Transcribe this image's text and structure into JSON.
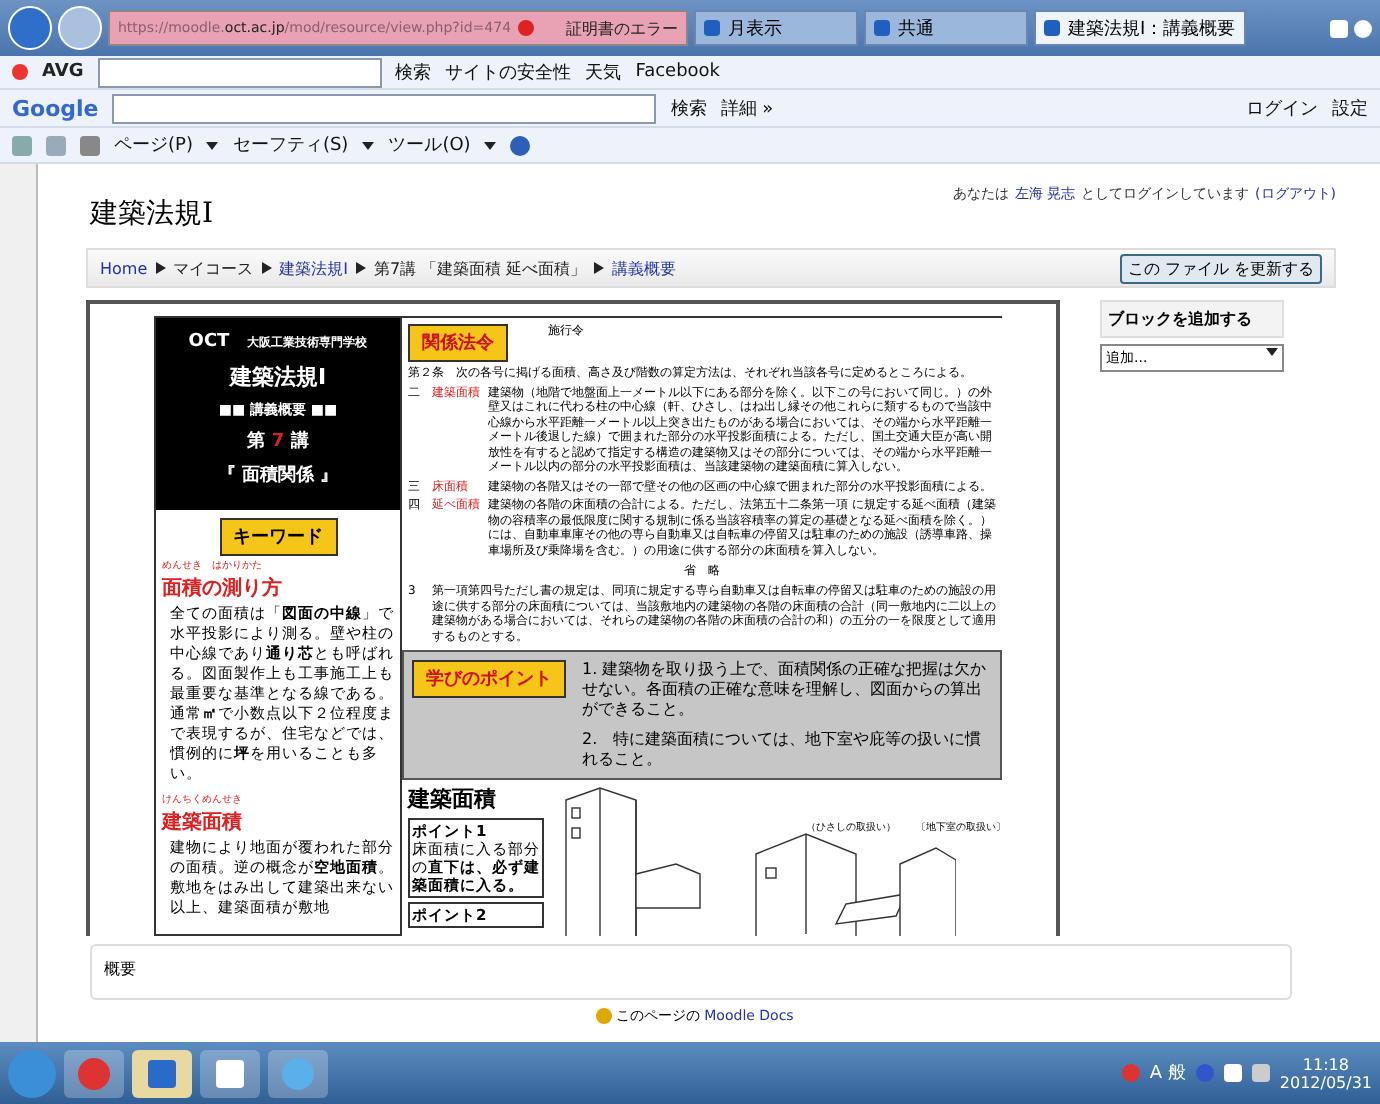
{
  "browser": {
    "url_prefix": "https://moodle.",
    "url_host": "oct.ac.jp",
    "url_path": "/mod/resource/view.php?id=474",
    "cert_error": "証明書のエラー",
    "tabs": [
      {
        "label": "月表示",
        "selected": false
      },
      {
        "label": "共通",
        "selected": false
      },
      {
        "label": "建築法規Ⅰ：講義概要",
        "selected": true
      }
    ]
  },
  "avg_toolbar": {
    "logo": "AVG",
    "search": "検索",
    "site_safety": "サイトの安全性",
    "weather": "天気",
    "facebook": "Facebook"
  },
  "google_toolbar": {
    "logo": "Google",
    "search": "検索",
    "more": "詳細 »",
    "login": "ログイン",
    "settings": "設定"
  },
  "command_bar": {
    "menus": [
      "ページ(P)",
      "セーフティ(S)",
      "ツール(O)"
    ]
  },
  "page": {
    "title": "建築法規Ⅰ",
    "login_prefix": "あなたは",
    "user": "左海 晃志",
    "login_suffix": "としてログインしています",
    "logout": "(ログアウト)",
    "breadcrumb": [
      {
        "label": "Home",
        "link": true
      },
      {
        "label": "マイコース",
        "link": false
      },
      {
        "label": "建築法規Ⅰ",
        "link": true
      },
      {
        "label": "第7講 「建築面積 延べ面積」",
        "link": false
      },
      {
        "label": "講義概要",
        "link": true
      }
    ],
    "update_button": "この ファイル を更新する",
    "block": {
      "title": "ブロックを追加する",
      "select": "追加..."
    },
    "summary": "概要",
    "docs_prefix": "このページの",
    "docs_link": "Moodle Docs"
  },
  "document": {
    "school": "OCT",
    "school_name": "大阪工業技術専門学校",
    "course": "建築法規Ⅰ",
    "subtitle": "■■ 講義概要 ■■",
    "lecture_prefix": "第",
    "lecture_no": "7",
    "lecture_suffix": "講",
    "topic": "『 面積関係 』",
    "keyword_label": "キーワード",
    "keywords": [
      {
        "ruby": "めんせき　はかりかた",
        "term": "面積の測り方",
        "text": "全ての面積は「**図面の中線**」で水平投影により測る。壁や柱の中心線であり**通り芯**とも呼ばれる。図面製作上も工事施工上も最重要な基準となる線である。通常**㎡**で小数点以下２位程度まで表現するが、住宅などでは、慣例的に**坪**を用いることも多い。"
      },
      {
        "ruby": "けんちくめんせき",
        "term": "建築面積",
        "text": "建物により地面が覆われた部分の面積。逆の概念が**空地面積**。敷地をはみ出して建築出来ない以上、建築面積が敷地"
      }
    ],
    "law_label": "関係法令",
    "law_title": "施行令",
    "law_intro": "第２条　次の各号に掲げる面積、高さ及び階数の算定方法は、それぞれ当該各号に定めるところによる。",
    "law_items": [
      {
        "no": "二",
        "term": "建築面積",
        "text": "建築物（地階で地盤面上一メートル以下にある部分を除く。以下この号において同じ。）の外壁又はこれに代わる柱の中心線（軒、ひさし、はね出し縁その他これらに類するもので当該中心線から水平距離一メートル以上突き出たものがある場合においては、その端から水平距離一メートル後退した線）で囲まれた部分の水平投影面積による。ただし、国土交通大臣が高い開放性を有すると認めて指定する構造の建築物又はその部分については、その端から水平距離一メートル以内の部分の水平投影面積は、当該建築物の建築面積に算入しない。"
      },
      {
        "no": "三",
        "term": "床面積",
        "text": "建築物の各階又はその一部で壁その他の区画の中心線で囲まれた部分の水平投影面積による。"
      },
      {
        "no": "四",
        "term": "延べ面積",
        "text": "建築物の各階の床面積の合計による。ただし、法第五十二条第一項 に規定する延べ面積（建築物の容積率の最低限度に関する規制に係る当該容積率の算定の基礎となる延べ面積を除く。）には、自動車車庫その他の専ら自動車又は自転車の停留又は駐車のための施設（誘導車路、操車場所及び乗降場を含む。）の用途に供する部分の床面積を算入しない。"
      }
    ],
    "law_omitted": "省　略",
    "law_para": {
      "no": "3",
      "text": "第一項第四号ただし書の規定は、同項に規定する専ら自動車又は自転車の停留又は駐車のための施設の用途に供する部分の床面積については、当該敷地内の建築物の各階の床面積の合計（同一敷地内に二以上の建築物がある場合においては、それらの建築物の各階の床面積の合計の和）の五分の一を限度として適用するものとする。"
    },
    "points_label": "学びのポイント",
    "points": [
      "1. 建築物を取り扱う上で、面積関係の正確な把握は欠かせない。各面積の正確な意味を理解し、図面からの算出ができること。",
      "2.　特に建築面積については、地下室や庇等の扱いに慣れること。"
    ],
    "section_title": "建築面積",
    "point_boxes": [
      {
        "title": "ポイント1",
        "text": "床面積に入る部分の**直下は、必ず建築面積に入る。**"
      },
      {
        "title": "ポイント2"
      }
    ],
    "figure_captions": [
      "（ひさしの取扱い）",
      "〔地下室の取扱い〕"
    ]
  },
  "taskbar": {
    "ime": "A 般",
    "time": "11:18",
    "date": "2012/05/31"
  }
}
